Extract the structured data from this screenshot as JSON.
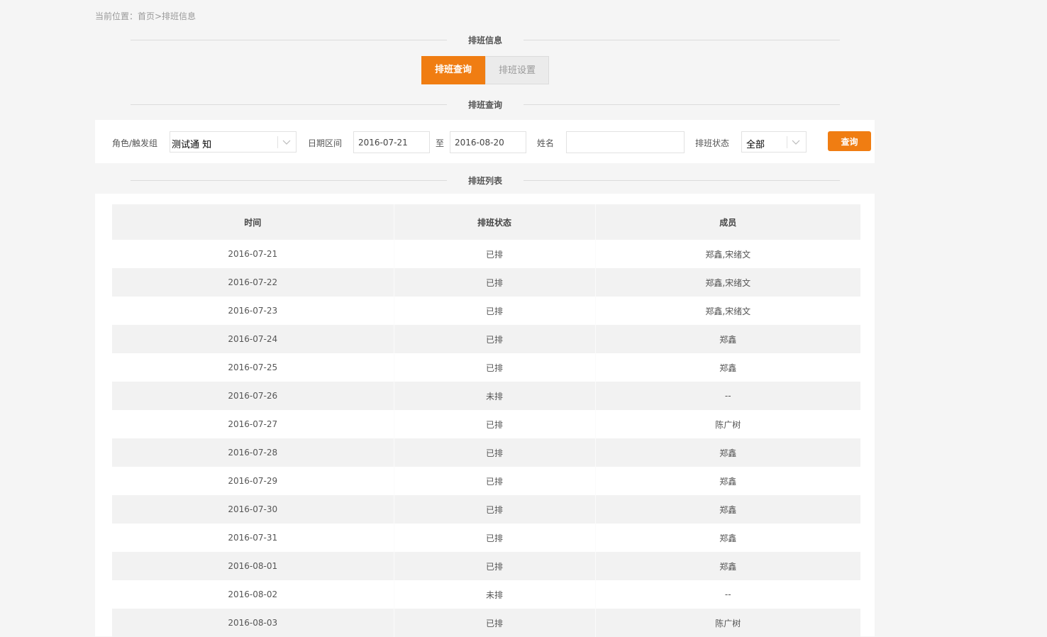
{
  "breadcrumb": "当前位置：首页>排班信息",
  "sections": {
    "info_title": "排班信息",
    "query_title": "排班查询",
    "list_title": "排班列表"
  },
  "tabs": [
    {
      "label": "排班查询",
      "active": true
    },
    {
      "label": "排班设置",
      "active": false
    }
  ],
  "filters": {
    "role_label": "角色/触发组",
    "role_value": "测试通 知",
    "date_label": "日期区间",
    "date_from": "2016-07-21",
    "date_sep": "至",
    "date_to": "2016-08-20",
    "name_label": "姓名",
    "name_value": "",
    "status_label": "排班状态",
    "status_value": "全部",
    "query_button": "查询"
  },
  "table": {
    "headers": [
      "时间",
      "排班状态",
      "成员"
    ],
    "rows": [
      {
        "date": "2016-07-21",
        "status": "已排",
        "members": "郑鑫,宋绪文"
      },
      {
        "date": "2016-07-22",
        "status": "已排",
        "members": "郑鑫,宋绪文"
      },
      {
        "date": "2016-07-23",
        "status": "已排",
        "members": "郑鑫,宋绪文"
      },
      {
        "date": "2016-07-24",
        "status": "已排",
        "members": "郑鑫"
      },
      {
        "date": "2016-07-25",
        "status": "已排",
        "members": "郑鑫"
      },
      {
        "date": "2016-07-26",
        "status": "未排",
        "members": "--"
      },
      {
        "date": "2016-07-27",
        "status": "已排",
        "members": "陈广树"
      },
      {
        "date": "2016-07-28",
        "status": "已排",
        "members": "郑鑫"
      },
      {
        "date": "2016-07-29",
        "status": "已排",
        "members": "郑鑫"
      },
      {
        "date": "2016-07-30",
        "status": "已排",
        "members": "郑鑫"
      },
      {
        "date": "2016-07-31",
        "status": "已排",
        "members": "郑鑫"
      },
      {
        "date": "2016-08-01",
        "status": "已排",
        "members": "郑鑫"
      },
      {
        "date": "2016-08-02",
        "status": "未排",
        "members": "--"
      },
      {
        "date": "2016-08-03",
        "status": "已排",
        "members": "陈广树"
      }
    ]
  },
  "colors": {
    "accent": "#f07d12",
    "background": "#f5f5f5",
    "stripe": "#f2f2f2"
  },
  "icons": {
    "select_arrow": "chevron-down-icon"
  }
}
